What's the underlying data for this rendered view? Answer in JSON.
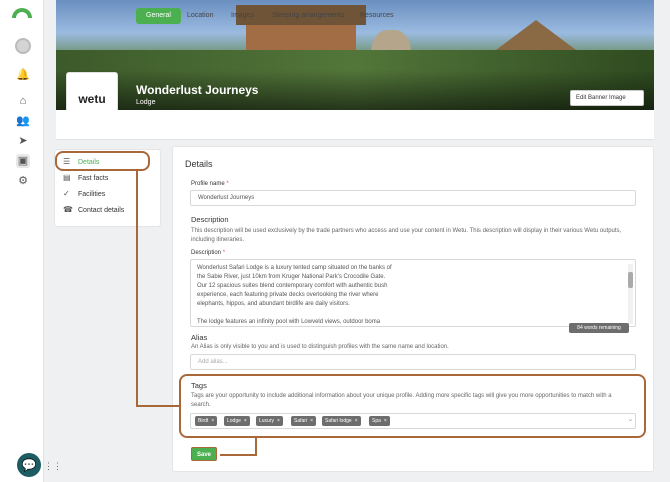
{
  "profile": {
    "name": "Wonderlust Journeys",
    "type": "Lodge",
    "logo_text": "wetu",
    "edit_banner_label": "Edit Banner Image"
  },
  "tabs": [
    {
      "label": "General",
      "active": true
    },
    {
      "label": "Location"
    },
    {
      "label": "Images"
    },
    {
      "label": "Sleeping arrangements"
    },
    {
      "label": "Resources"
    }
  ],
  "side_nav": [
    {
      "label": "Details",
      "icon": "list-icon",
      "active": true
    },
    {
      "label": "Fast facts",
      "icon": "clipboard-icon"
    },
    {
      "label": "Facilities",
      "icon": "check-circle-icon"
    },
    {
      "label": "Contact details",
      "icon": "phone-icon"
    }
  ],
  "details": {
    "heading": "Details",
    "profile_name_label": "Profile name",
    "profile_name_value": "Wonderlust Journeys",
    "description_title": "Description",
    "description_help": "This description will be used exclusively by the trade partners who access and use your content in Wetu. This description will display in their various Wetu outputs, including itineraries.",
    "description_label": "Description",
    "description_lines": [
      "Wonderlust Safari Lodge is a luxury tented camp situated on the banks of",
      "the Sabie River, just 10km from Kruger National Park's Crocodile Gate.",
      "Our 12 spacious suites blend contemporary comfort with authentic bush",
      "experience, each featuring private decks overlooking the river where",
      "elephants, hippos, and abundant birdlife are daily visitors.",
      "",
      "The lodge features an infinity pool with Lowveld views, outdoor boma"
    ],
    "words_remaining": "84 words remaining",
    "alias_title": "Alias",
    "alias_help": "An Alias is only visible to you and is used to distinguish profiles with the same name and location.",
    "alias_placeholder": "Add alias...",
    "tags_title": "Tags",
    "tags_help": "Tags are your opportunity to include additional information about your unique profile. Adding more specific tags will give you more opportunities to match with a search.",
    "tags": [
      "Birdt",
      "Lodge",
      "Luxury",
      "Safari",
      "Safari lodge",
      "Spa"
    ],
    "save_label": "Save"
  },
  "colors": {
    "accent": "#4caf50",
    "highlight": "#a8683a"
  }
}
